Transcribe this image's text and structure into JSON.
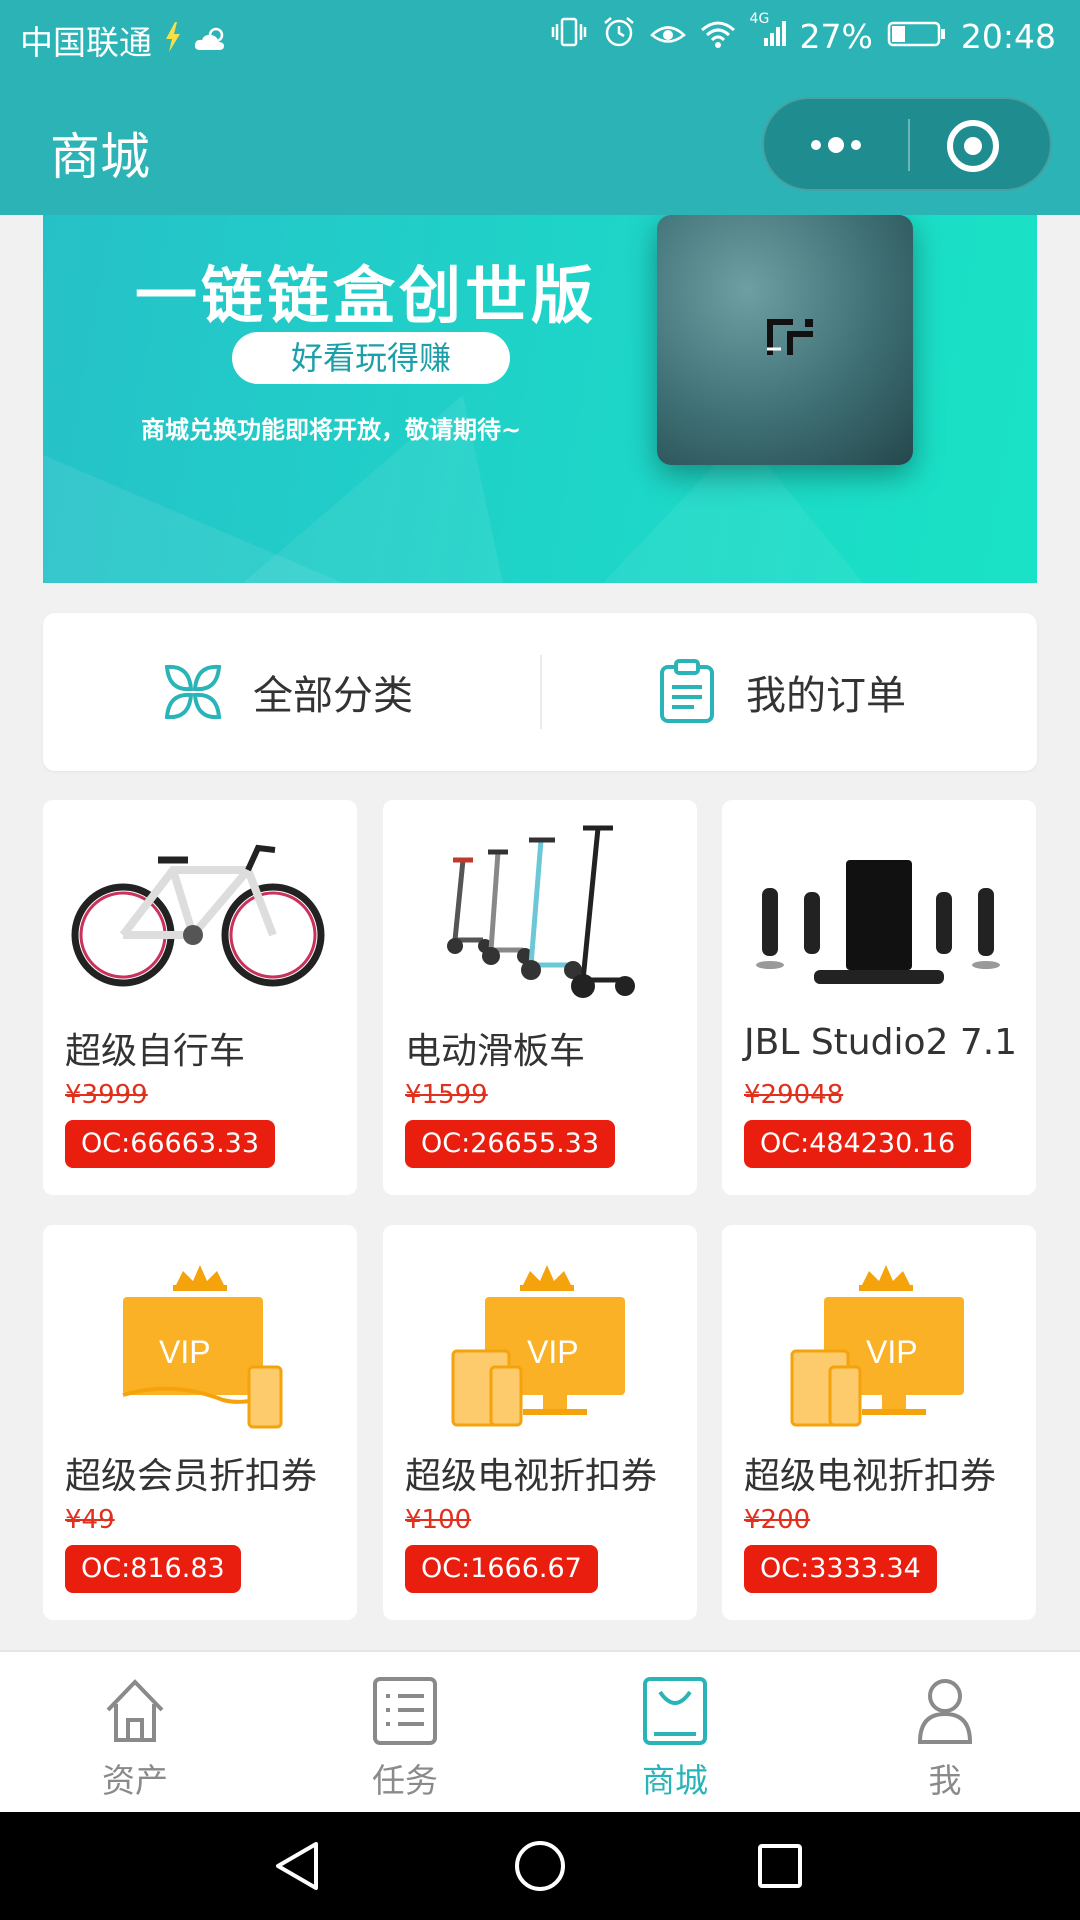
{
  "status_bar": {
    "carrier": "中国联通",
    "network": "4G",
    "battery": "27%",
    "time": "20:48"
  },
  "header": {
    "title": "商城"
  },
  "banner": {
    "title": "一链链盒创世版",
    "tagline": "好看玩得赚",
    "subtitle": "商城兑换功能即将开放，敬请期待~"
  },
  "quick_actions": [
    {
      "label": "全部分类",
      "icon": "category-grid-icon"
    },
    {
      "label": "我的订单",
      "icon": "clipboard-icon"
    }
  ],
  "products": [
    {
      "name": "超级自行车",
      "price": "¥3999",
      "oc": "OC:66663.33",
      "image": "bicycle-image"
    },
    {
      "name": "电动滑板车",
      "price": "¥1599",
      "oc": "OC:26655.33",
      "image": "scooter-image"
    },
    {
      "name": "JBL Studio2 7.1",
      "price": "¥29048",
      "oc": "OC:484230.16",
      "image": "speaker-set-image"
    },
    {
      "name": "超级会员折扣券",
      "price": "¥49",
      "oc": "OC:816.83",
      "image": "vip-coupon-image"
    },
    {
      "name": "超级电视折扣券",
      "price": "¥100",
      "oc": "OC:1666.67",
      "image": "vip-tv-image"
    },
    {
      "name": "超级电视折扣券",
      "price": "¥200",
      "oc": "OC:3333.34",
      "image": "vip-tv-image"
    }
  ],
  "tabs": [
    {
      "label": "资产",
      "icon": "home-icon",
      "active": false
    },
    {
      "label": "任务",
      "icon": "task-list-icon",
      "active": false
    },
    {
      "label": "商城",
      "icon": "shop-bag-icon",
      "active": true
    },
    {
      "label": "我",
      "icon": "user-icon",
      "active": false
    }
  ],
  "colors": {
    "primary": "#2cb3b6",
    "oc_badge": "#ea1e0f",
    "strike_price": "#e0301e",
    "active_tab": "#2ab4b7"
  }
}
